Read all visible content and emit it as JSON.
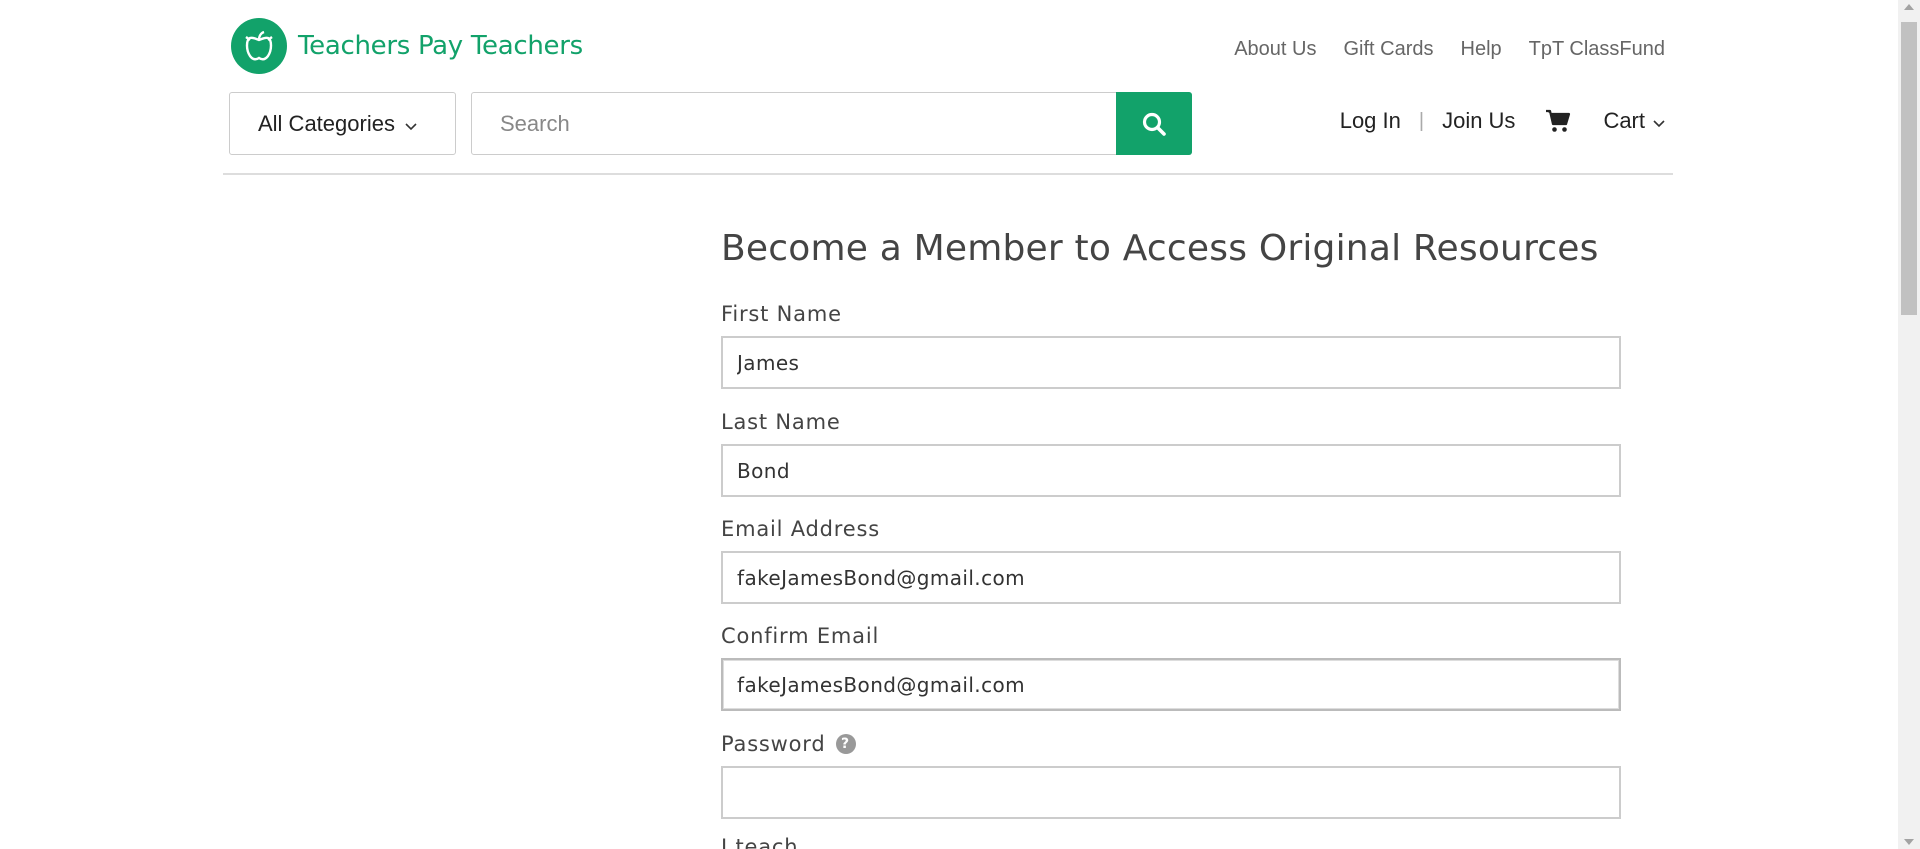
{
  "brand": {
    "name": "Teachers Pay Teachers",
    "color": "#12a26a"
  },
  "top_nav": {
    "links": [
      "About Us",
      "Gift Cards",
      "Help",
      "TpT ClassFund"
    ]
  },
  "search_bar": {
    "category_label": "All Categories",
    "placeholder": "Search",
    "value": ""
  },
  "account": {
    "login": "Log In",
    "separator": "|",
    "join": "Join Us",
    "cart": "Cart"
  },
  "form": {
    "title": "Become a Member to Access Original Resources",
    "first_name": {
      "label": "First Name",
      "value": "James"
    },
    "last_name": {
      "label": "Last Name",
      "value": "Bond"
    },
    "email": {
      "label": "Email Address",
      "value": "fakeJamesBond@gmail.com"
    },
    "confirm_email": {
      "label": "Confirm Email",
      "value": "fakeJamesBond@gmail.com"
    },
    "password": {
      "label": "Password",
      "value": "",
      "help_icon": "?"
    },
    "next_label_partial": "I teach"
  }
}
